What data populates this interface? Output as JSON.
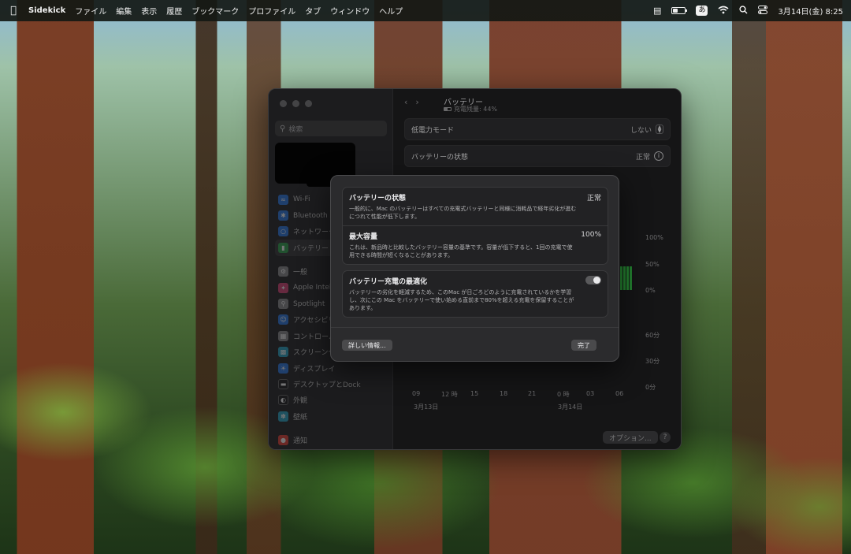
{
  "menubar": {
    "app_name": "Sidekick",
    "items": [
      "ファイル",
      "編集",
      "表示",
      "履歴",
      "ブックマーク",
      "プロファイル",
      "タブ",
      "ウィンドウ",
      "ヘルプ"
    ],
    "ime_label": "あ",
    "datetime": "3月14日(金)  8:25"
  },
  "window": {
    "search_placeholder": "検索",
    "sidebar": [
      "Wi-Fi",
      "Bluetooth",
      "ネットワーク",
      "バッテリー",
      "一般",
      "Apple Intelligence",
      "Spotlight",
      "アクセシビリティ",
      "コントロール",
      "スクリーンセーバ",
      "ディスプレイ",
      "デスクトップとDock",
      "外観",
      "壁紙",
      "通知"
    ],
    "selected_sidebar": "バッテリー",
    "title": "バッテリー",
    "subtitle": "充電残量: 44%",
    "rows": {
      "low_power_label": "低電力モード",
      "low_power_value": "しない",
      "health_label": "バッテリーの状態",
      "health_value": "正常"
    },
    "options_button": "オプション...",
    "help_button": "?"
  },
  "chart_data": {
    "type": "bar",
    "title": "",
    "pct_ticks": [
      "100%",
      "50%",
      "0%"
    ],
    "min_ticks": [
      "60分",
      "30分",
      "0分"
    ],
    "x_ticks": [
      "09",
      "12 時",
      "15",
      "18",
      "21",
      "0 時",
      "03",
      "06"
    ],
    "dates": [
      "3月13日",
      "3月14日"
    ],
    "ylim": [
      0,
      100
    ]
  },
  "sheet": {
    "health_title": "バッテリーの状態",
    "health_value": "正常",
    "health_desc": "一般的に、Mac のバッテリーはすべての充電式バッテリーと同様に消耗品で経年劣化が進むにつれて性能が低下します。",
    "capacity_title": "最大容量",
    "capacity_value": "100%",
    "capacity_desc": "これは、新品時と比較したバッテリー容量の基準です。容量が低下すると、1回の充電で使用できる時間が短くなることがあります。",
    "optimize_title": "バッテリー充電の最適化",
    "optimize_on": true,
    "optimize_desc": "バッテリーの劣化を軽減するため、このMac が日ごろどのように充電されているかを学習し、次にこの Mac をバッテリーで使い始める直前まで80%を超える充電を保留することがあります。",
    "more_info_button": "詳しい情報...",
    "done_button": "完了"
  }
}
